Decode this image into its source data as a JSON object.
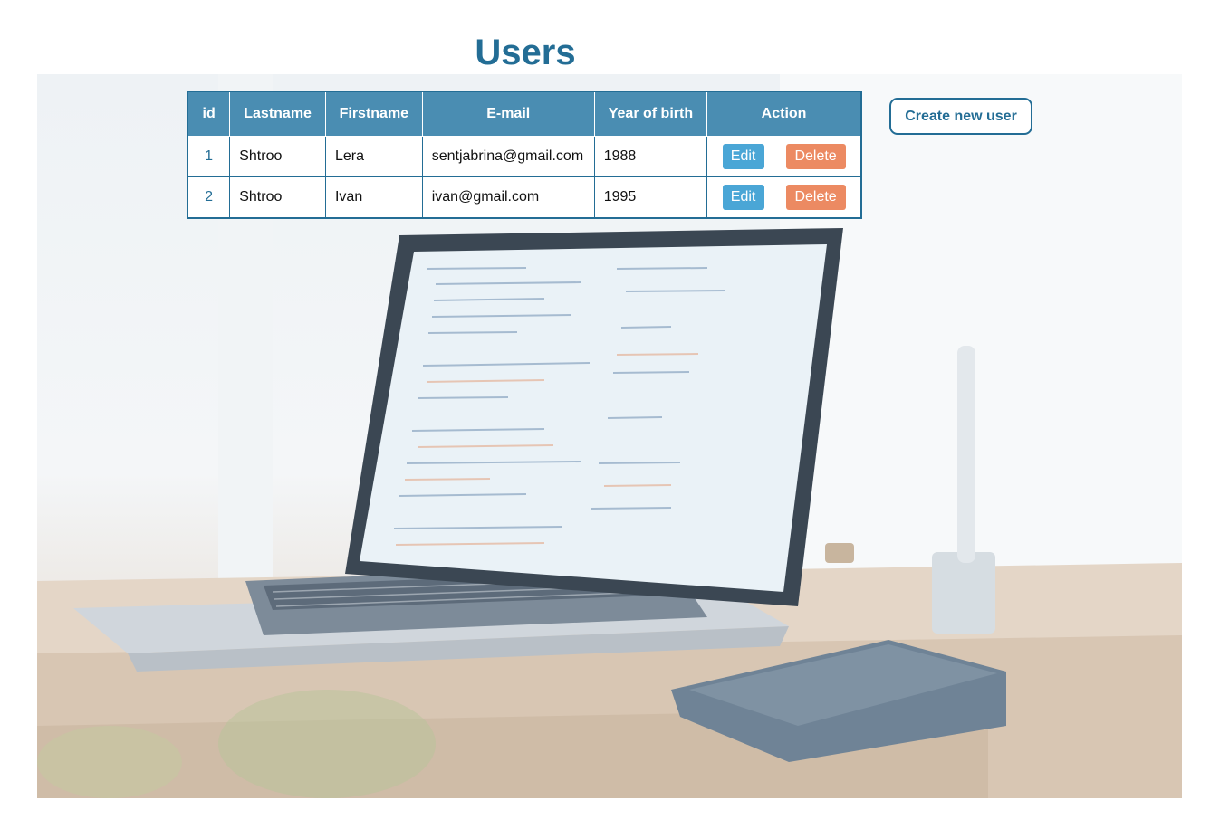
{
  "page": {
    "title": "Users"
  },
  "table": {
    "headers": [
      "id",
      "Lastname",
      "Firstname",
      "E-mail",
      "Year of birth",
      "Action"
    ],
    "rows": [
      {
        "id": "1",
        "lastname": "Shtroo",
        "firstname": "Lera",
        "email": "sentjabrina@gmail.com",
        "year": "1988"
      },
      {
        "id": "2",
        "lastname": "Shtroo",
        "firstname": "Ivan",
        "email": "ivan@gmail.com",
        "year": "1995"
      }
    ],
    "edit_label": "Edit",
    "delete_label": "Delete"
  },
  "actions": {
    "create_label": "Create new user"
  },
  "colors": {
    "accent": "#236d95",
    "header_bg": "#4a8db2",
    "edit_button": "#4aa6d6",
    "delete_button": "#ec8a62"
  },
  "background": {
    "image": "laptop-on-desk-photo"
  }
}
